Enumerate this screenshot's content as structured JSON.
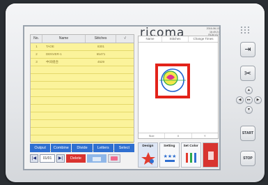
{
  "brand": {
    "name": "ricoma",
    "info": [
      "2016-08-13",
      "16:49:21",
      "RCM V17"
    ]
  },
  "table": {
    "headers": [
      "No.",
      "Name",
      "Stitches",
      "√"
    ],
    "rows": [
      {
        "no": "1",
        "name": "TAOE",
        "stitches": "8301"
      },
      {
        "no": "2",
        "name": "DENVER-1",
        "stitches": "65471"
      },
      {
        "no": "3",
        "name": "中间组合",
        "stitches": "4529"
      }
    ]
  },
  "actions": [
    "Output",
    "Combine",
    "Divide",
    "Letters",
    "Select"
  ],
  "pager": {
    "page": "01/01",
    "delete_label": "Delete"
  },
  "preview": {
    "headers": [
      "Name",
      "Stitches",
      "Change Times"
    ],
    "footer": [
      "Size",
      "X",
      "Y"
    ]
  },
  "bottom_tabs": [
    {
      "label": "Design"
    },
    {
      "label": "Setting"
    },
    {
      "label": "Set Color"
    },
    {
      "label": ""
    }
  ],
  "hardware": {
    "start": "START",
    "stop": "STOP"
  }
}
